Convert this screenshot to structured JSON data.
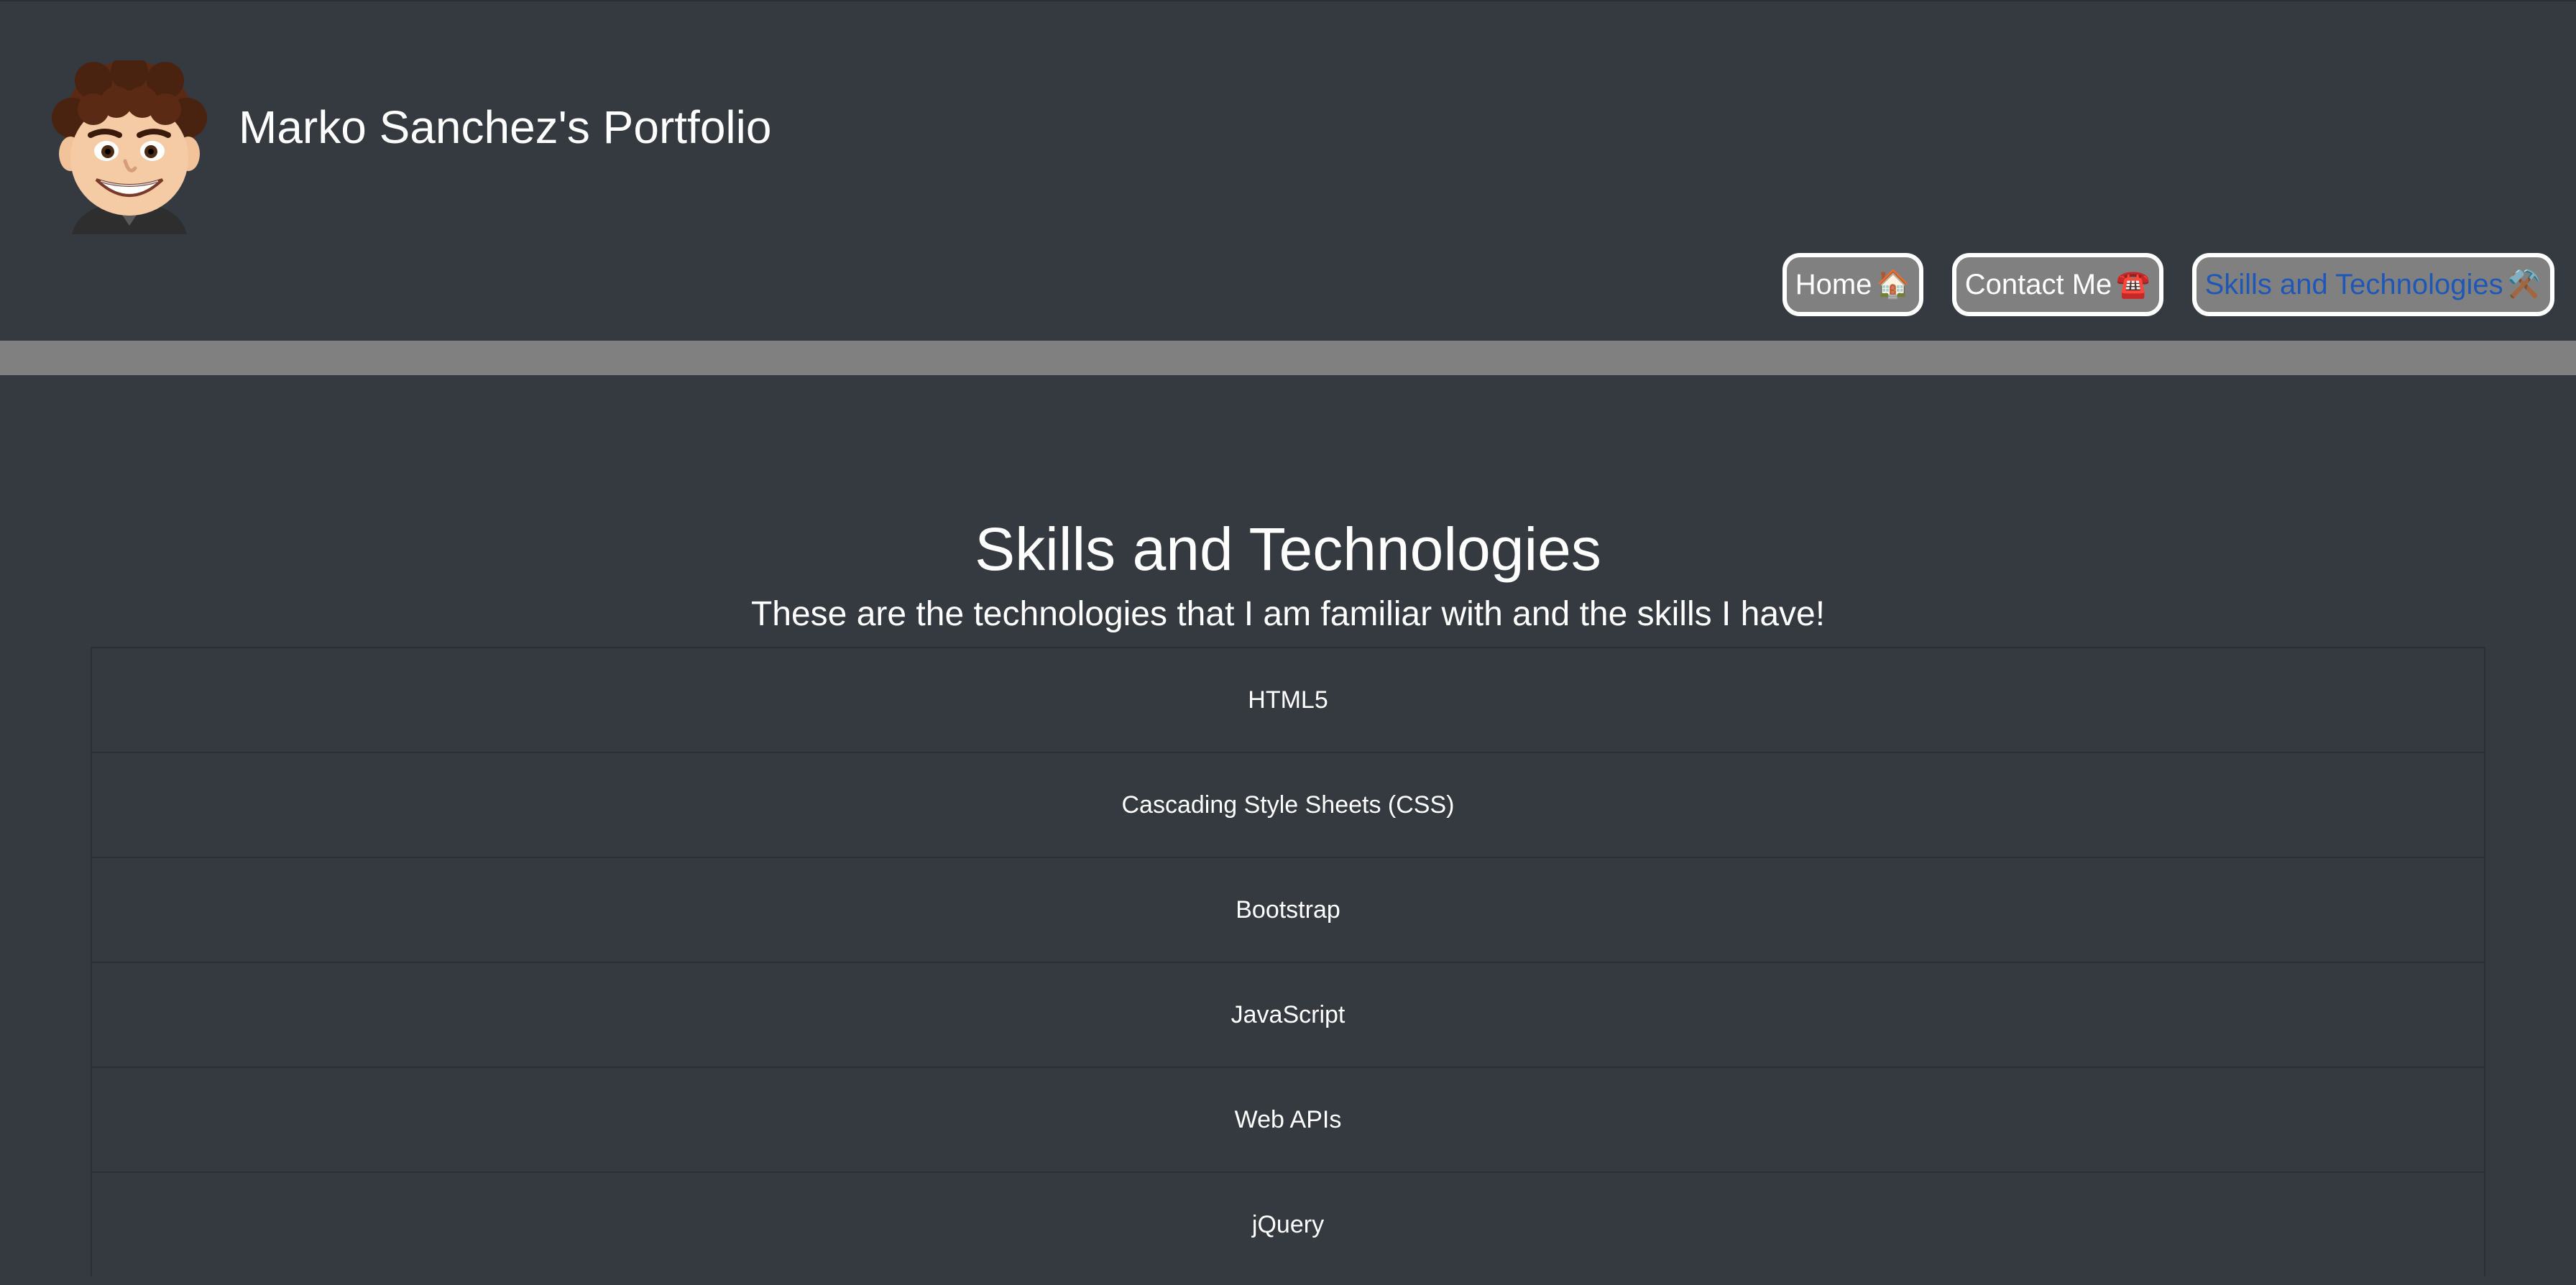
{
  "header": {
    "title": "Marko Sanchez's Portfolio",
    "avatar_icon": "cartoon-avatar"
  },
  "nav": {
    "items": [
      {
        "label": "Home",
        "icon": "🏠",
        "active": false
      },
      {
        "label": "Contact Me",
        "icon": "☎️",
        "active": false
      },
      {
        "label": "Skills and Technologies",
        "icon": "⚒️",
        "active": true
      }
    ]
  },
  "main": {
    "title": "Skills and Technologies",
    "subtitle": "These are the technologies that I am familiar with and the skills I have!",
    "skills": [
      "HTML5",
      "Cascading Style Sheets (CSS)",
      "Bootstrap",
      "JavaScript",
      "Web APIs",
      "jQuery"
    ]
  },
  "colors": {
    "background": "#343a40",
    "divider": "#808080",
    "nav_button_bg": "#808080",
    "active_link": "#1f57b7",
    "text": "#ffffff"
  }
}
